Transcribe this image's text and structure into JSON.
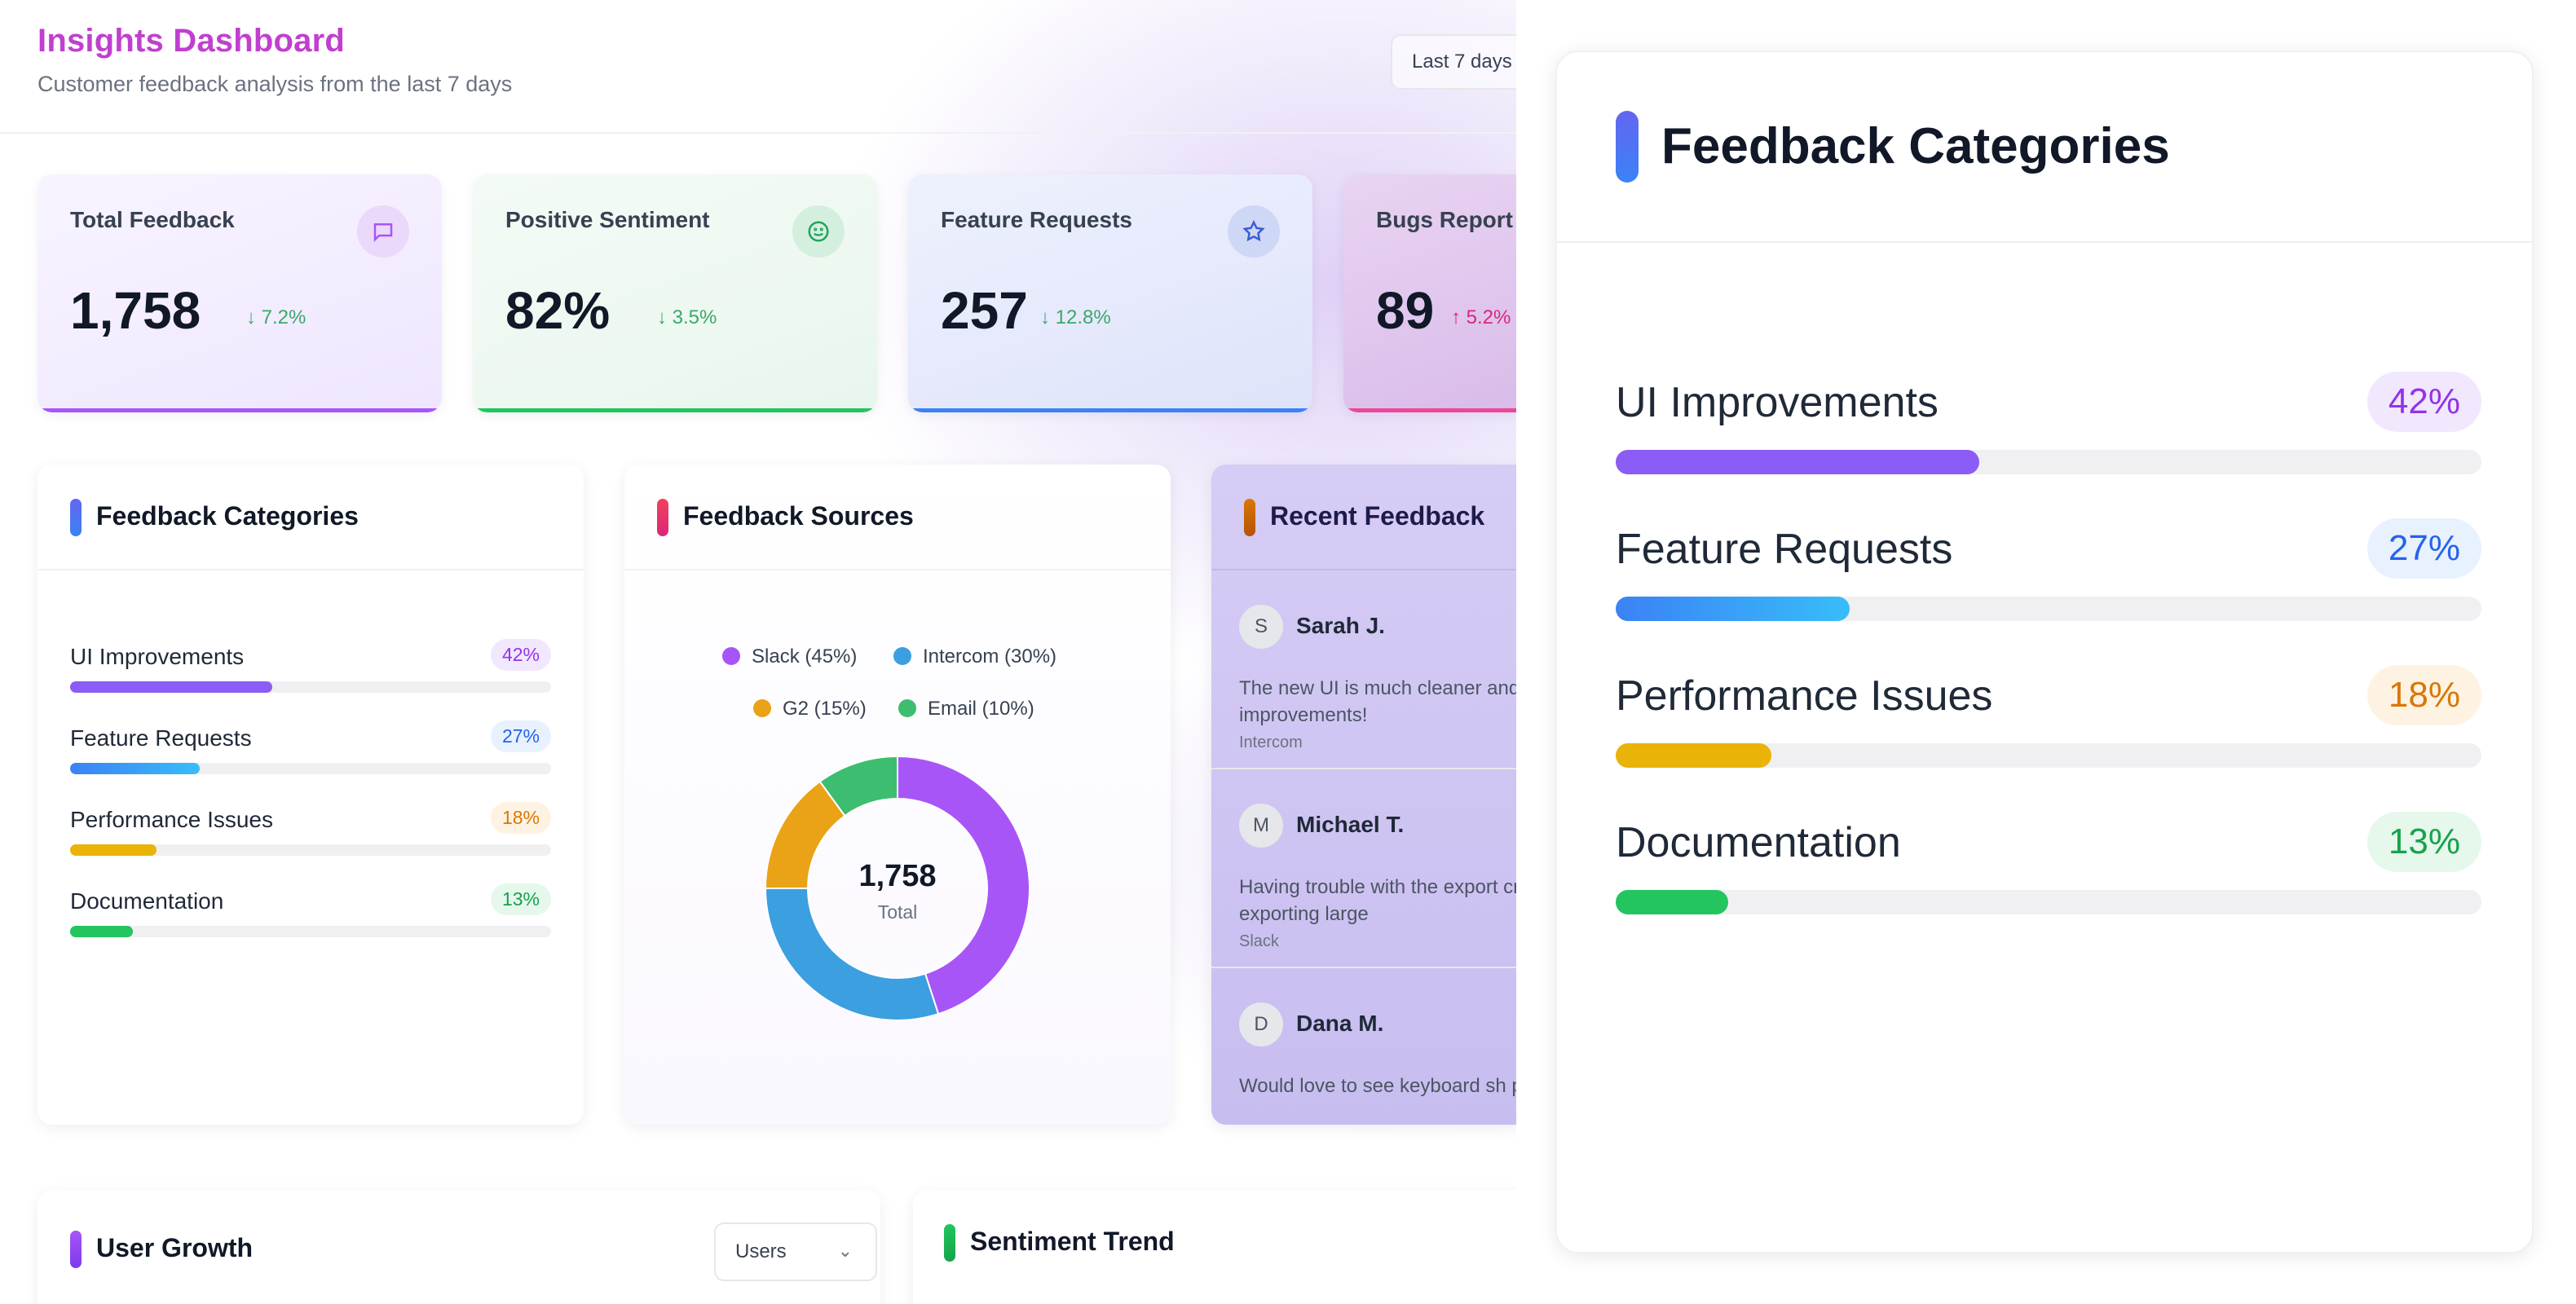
{
  "header": {
    "title": "Insights Dashboard",
    "subtitle": "Customer feedback analysis from the last 7 days",
    "range_button": "Last 7 days"
  },
  "stats": [
    {
      "label": "Total Feedback",
      "value": "1,758",
      "change": "↓ 7.2%",
      "icon": "message-icon",
      "accent": "#a855f7"
    },
    {
      "label": "Positive Sentiment",
      "value": "82%",
      "change": "↓ 3.5%",
      "icon": "smile-icon",
      "accent": "#22c55e"
    },
    {
      "label": "Feature Requests",
      "value": "257",
      "change": "↓ 12.8%",
      "icon": "star-icon",
      "accent": "#3b82f6"
    },
    {
      "label": "Bugs Report",
      "value": "89",
      "change": "↑ 5.2%",
      "icon": "bug-icon",
      "accent": "#ec4899"
    }
  ],
  "categories": {
    "title": "Feedback Categories",
    "items": [
      {
        "name": "UI Improvements",
        "pct_label": "42%",
        "pct": 42,
        "color": "#8b5cf6"
      },
      {
        "name": "Feature Requests",
        "pct_label": "27%",
        "pct": 27,
        "color": "#3b82f6"
      },
      {
        "name": "Performance Issues",
        "pct_label": "18%",
        "pct": 18,
        "color": "#eab308"
      },
      {
        "name": "Documentation",
        "pct_label": "13%",
        "pct": 13,
        "color": "#22c55e"
      }
    ]
  },
  "sources": {
    "title": "Feedback Sources",
    "legend": [
      "Slack (45%)",
      "Intercom (30%)",
      "G2 (15%)",
      "Email (10%)"
    ],
    "center_value": "1,758",
    "center_label": "Total"
  },
  "chart_data": {
    "type": "pie",
    "categories": [
      "Slack",
      "Intercom",
      "G2",
      "Email"
    ],
    "values": [
      45,
      30,
      15,
      10
    ],
    "colors": [
      "#a855f7",
      "#3b9fe0",
      "#eaa216",
      "#3dbd6f"
    ],
    "title": "Feedback Sources"
  },
  "recent": {
    "title": "Recent Feedback",
    "items": [
      {
        "initial": "S",
        "name": "Sarah J.",
        "text": "The new UI is much cleaner and Love the improvements!",
        "source": "Intercom"
      },
      {
        "initial": "M",
        "name": "Michael T.",
        "text": "Having trouble with the export crashes when exporting large",
        "source": "Slack"
      },
      {
        "initial": "D",
        "name": "Dana M.",
        "text": "Would love to see keyboard sh power users.",
        "source": ""
      }
    ]
  },
  "user_growth": {
    "title": "User Growth",
    "select_value": "Users"
  },
  "sentiment": {
    "title": "Sentiment Trend"
  },
  "panel": {
    "title": "Feedback Categories",
    "items": [
      {
        "name": "UI Improvements",
        "pct_label": "42%"
      },
      {
        "name": "Feature Requests",
        "pct_label": "27%"
      },
      {
        "name": "Performance Issues",
        "pct_label": "18%"
      },
      {
        "name": "Documentation",
        "pct_label": "13%"
      }
    ]
  }
}
